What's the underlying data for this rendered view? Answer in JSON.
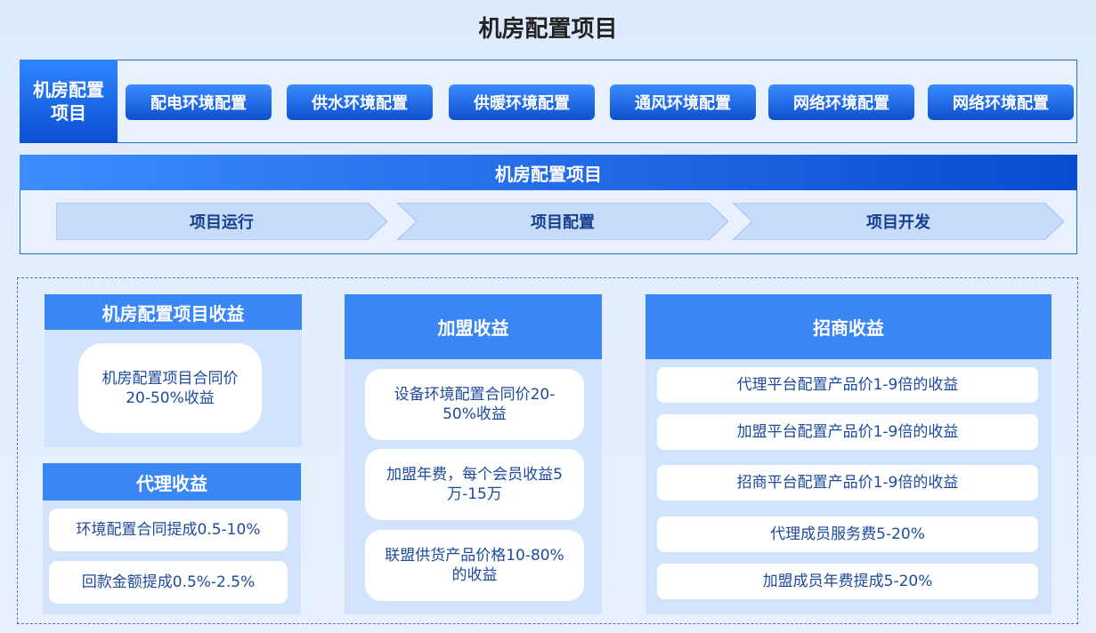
{
  "title": "机房配置项目",
  "row1": {
    "label": "机房配置项目",
    "buttons": [
      "配电环境配置",
      "供水环境配置",
      "供暖环境配置",
      "通风环境配置",
      "网络环境配置",
      "网络环境配置"
    ]
  },
  "row2": {
    "header": "机房配置项目",
    "steps": [
      "项目运行",
      "项目配置",
      "项目开发"
    ]
  },
  "panels": {
    "project": {
      "title": "机房配置项目收益",
      "items": [
        "机房配置项目合同价20-50%收益"
      ]
    },
    "agent": {
      "title": "代理收益",
      "items": [
        "环境配置合同提成0.5-10%",
        "回款金额提成0.5%-2.5%"
      ]
    },
    "franchise": {
      "title": "加盟收益",
      "items": [
        "设备环境配置合同价20-50%收益",
        "加盟年费，每个会员收益5万-15万",
        "联盟供货产品价格10-80%的收益"
      ]
    },
    "investment": {
      "title": "招商收益",
      "items": [
        "代理平台配置产品价1-9倍的收益",
        "加盟平台配置产品价1-9倍的收益",
        "招商平台配置产品价1-9倍的收益",
        "代理成员服务费5-20%",
        "加盟成员年费提成5-20%"
      ]
    }
  },
  "colors": {
    "primary": "#0b4fd2",
    "accent": "#3a86f4",
    "panel_bg": "#d2e3fd",
    "arrow_fill": "#c7dcfb"
  }
}
